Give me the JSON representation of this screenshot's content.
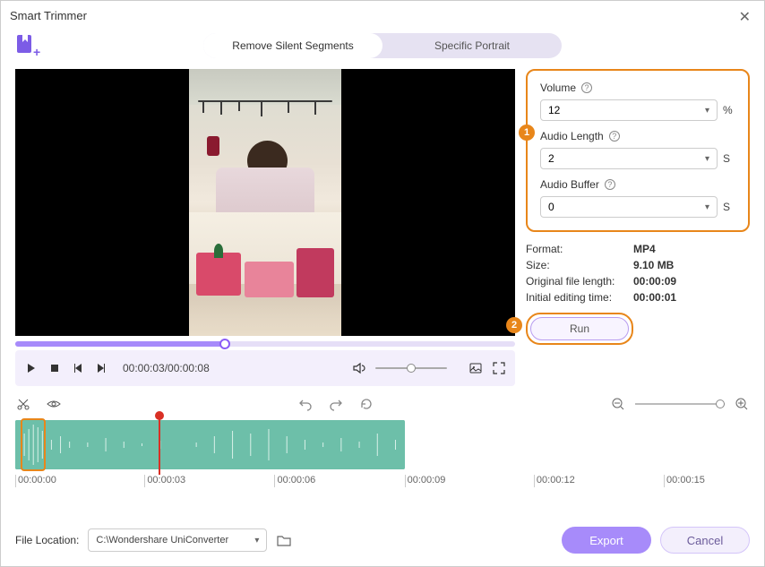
{
  "window": {
    "title": "Smart Trimmer"
  },
  "modes": {
    "remove_silent": "Remove Silent Segments",
    "specific_portrait": "Specific Portrait"
  },
  "playback": {
    "time_display": "00:00:03/00:00:08"
  },
  "settings": {
    "volume": {
      "label": "Volume",
      "value": "12",
      "unit": "%"
    },
    "audio_length": {
      "label": "Audio Length",
      "value": "2",
      "unit": "S"
    },
    "audio_buffer": {
      "label": "Audio Buffer",
      "value": "0",
      "unit": "S"
    }
  },
  "badges": {
    "one": "1",
    "two": "2"
  },
  "info": {
    "format": {
      "label": "Format:",
      "value": "MP4"
    },
    "size": {
      "label": "Size:",
      "value": "9.10 MB"
    },
    "original_length": {
      "label": "Original file length:",
      "value": "00:00:09"
    },
    "initial_editing": {
      "label": "Initial editing time:",
      "value": "00:00:01"
    }
  },
  "run": {
    "label": "Run"
  },
  "timeline": {
    "ticks": [
      "00:00:00",
      "00:00:03",
      "00:00:06",
      "00:00:09",
      "00:00:12",
      "00:00:15"
    ]
  },
  "footer": {
    "location_label": "File Location:",
    "location_value": "C:\\Wondershare UniConverter",
    "export": "Export",
    "cancel": "Cancel"
  }
}
